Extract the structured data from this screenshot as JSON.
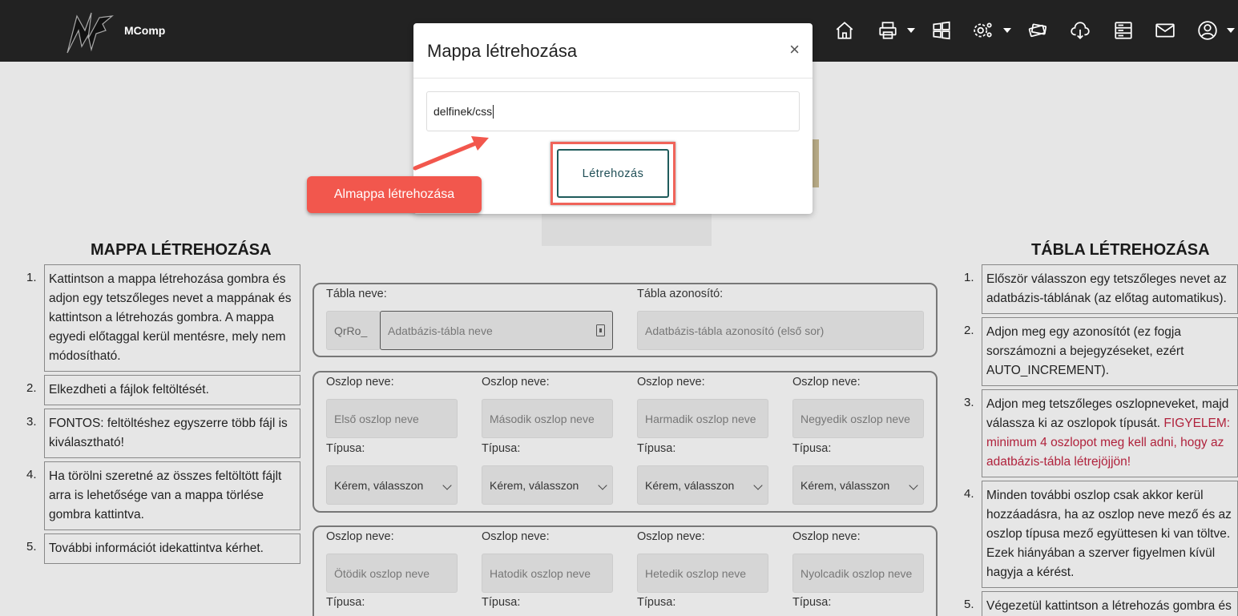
{
  "navbar": {
    "brand": "MComp",
    "icons": [
      "home-icon",
      "printer-icon",
      "windows-icon",
      "settings-icon",
      "ticket-icon",
      "cloud-download-icon",
      "server-icon",
      "mail-icon",
      "user-icon"
    ]
  },
  "modal": {
    "title": "Mappa létrehozása",
    "close": "×",
    "input_value": "delfinek/css",
    "button_label": "Létrehozás"
  },
  "annotation": {
    "label": "Almappa létrehozása",
    "color": "#f2574d"
  },
  "left_section": {
    "title": "MAPPA LÉTREHOZÁSA",
    "steps": [
      {
        "num": "1.",
        "text": "Kattintson a mappa létrehozása gombra és adjon egy tetszőleges nevet a mappának és kattintson a létrehozás gombra. A mappa egyedi előtaggal kerül mentésre, mely nem módosítható."
      },
      {
        "num": "2.",
        "text": "Elkezdheti a fájlok feltöltését."
      },
      {
        "num": "3.",
        "text": "FONTOS: feltöltéshez egyszerre több fájl is kiválasztható!"
      },
      {
        "num": "4.",
        "text": "Ha törölni szeretné az összes feltöltött fájlt arra is lehetősége van a mappa törlése gombra kattintva."
      },
      {
        "num": "5.",
        "text": "További információt idekattintva kérhet."
      }
    ]
  },
  "right_section": {
    "title": "TÁBLA LÉTREHOZÁSA",
    "steps": [
      {
        "num": "1.",
        "text": "Először válasszon egy tetszőleges nevet az adatbázis-táblának (az előtag automatikus)."
      },
      {
        "num": "2.",
        "text": "Adjon meg egy azonosítót (ez fogja sorszámozni a bejegyzéseket, ezért AUTO_INCREMENT)."
      },
      {
        "num": "3.",
        "text": "Adjon meg tetszőleges oszlopneveket, majd válassza ki az oszlopok típusát.",
        "warning": "FIGYELEM: minimum 4 oszlopot meg kell adni, hogy az adatbázis-tábla létrejöjjön!"
      },
      {
        "num": "4.",
        "text": "Minden további oszlop csak akkor kerül hozzáadásra, ha az oszlop neve mező és az oszlop típusa mező együttesen ki van töltve. Ezek hiányában a szerver figyelmen kívül hagyja a kérést."
      },
      {
        "num": "5.",
        "text": "Végezetül kattintson a létrehozás gombra és pár másodperc múlva el is készül a"
      }
    ]
  },
  "table_form": {
    "name_label": "Tábla neve:",
    "prefix": "QrRo_",
    "name_placeholder": "Adatbázis-tábla neve",
    "id_label": "Tábla azonosító:",
    "id_placeholder": "Adatbázis-tábla azonosító (első sor)",
    "col_label": "Oszlop neve:",
    "type_label": "Típusa:",
    "select_default": "Kérem, válasszon",
    "columns_row1": [
      "Első oszlop neve",
      "Második oszlop neve",
      "Harmadik oszlop neve",
      "Negyedik oszlop neve"
    ],
    "columns_row2": [
      "Ötödik oszlop neve",
      "Hatodik oszlop neve",
      "Hetedik oszlop neve",
      "Nyolcadik oszlop neve"
    ]
  }
}
